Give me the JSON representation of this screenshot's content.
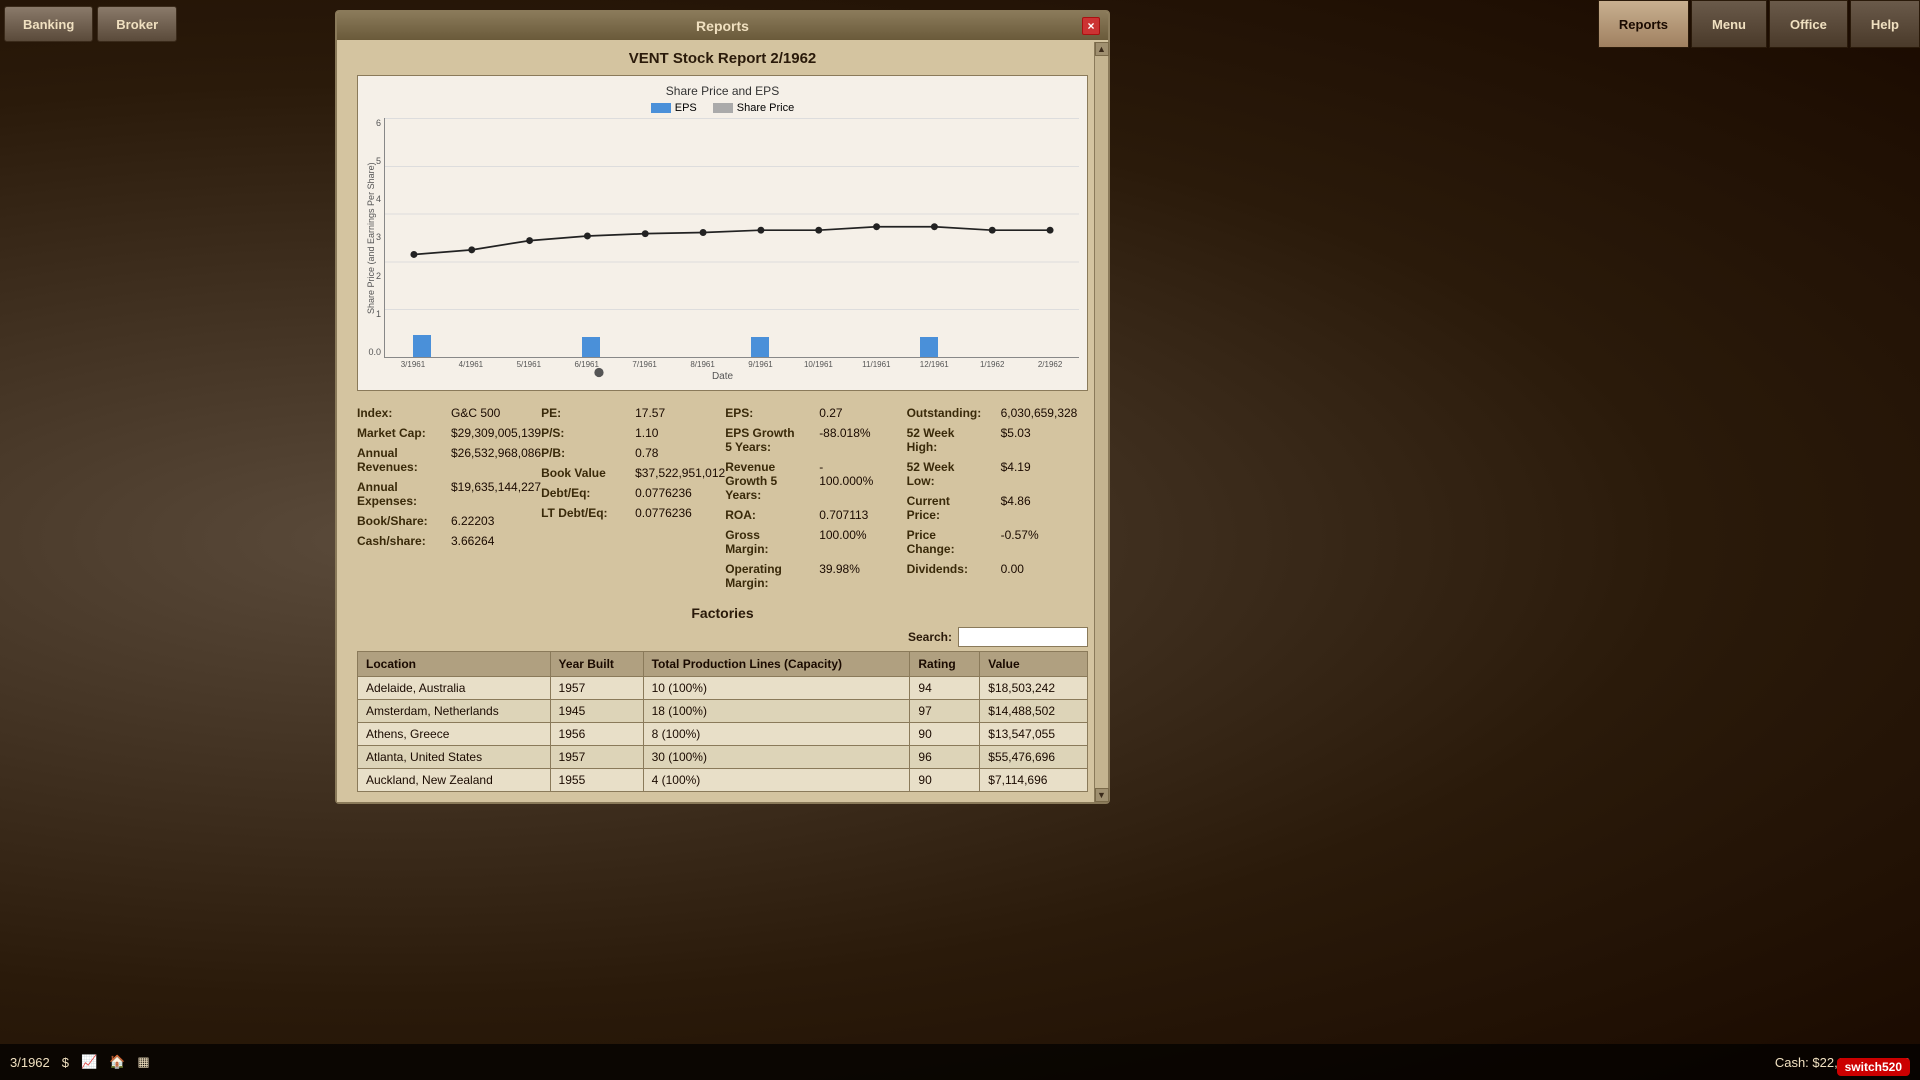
{
  "topbar": {
    "left_buttons": [
      {
        "label": "Banking",
        "id": "banking"
      },
      {
        "label": "Broker",
        "id": "broker"
      }
    ],
    "right_buttons": [
      {
        "label": "Reports",
        "id": "reports",
        "active": true
      },
      {
        "label": "Menu",
        "id": "menu"
      },
      {
        "label": "Office",
        "id": "office"
      },
      {
        "label": "Help",
        "id": "help"
      }
    ]
  },
  "window": {
    "title": "Reports",
    "close_label": "×"
  },
  "report": {
    "title": "VENT Stock Report 2/1962",
    "chart": {
      "title": "Share Price and EPS",
      "legend_eps": "EPS",
      "legend_price": "Share Price",
      "y_label": "Share Price (and Earnings Per Share)",
      "x_label": "Date",
      "x_labels": [
        "3/1961",
        "4/1961",
        "5/1961",
        "6/1961",
        "7/1961",
        "8/1961",
        "9/1961",
        "10/1961",
        "11/1961",
        "12/1961",
        "1/1962",
        "2/1962"
      ],
      "y_values": [
        "0.0",
        "1",
        "2",
        "3",
        "4",
        "5",
        "6"
      ],
      "bar_heights_pct": [
        20,
        2,
        2,
        18,
        2,
        2,
        17,
        2,
        2,
        16,
        2,
        2
      ],
      "line_points": "45,108 90,105 135,98 175,95 220,93 265,92 310,90 355,90 400,88 445,88 490,90 535,90"
    },
    "stats": {
      "col1": [
        {
          "label": "Index:",
          "value": "G&C 500"
        },
        {
          "label": "Market Cap:",
          "value": "$29,309,005,139"
        },
        {
          "label": "Annual Revenues:",
          "value": "$26,532,968,086"
        },
        {
          "label": "Annual Expenses:",
          "value": "$19,635,144,227"
        },
        {
          "label": "Book/Share:",
          "value": "6.22203"
        },
        {
          "label": "Cash/share:",
          "value": "3.66264"
        }
      ],
      "col2": [
        {
          "label": "PE:",
          "value": "17.57"
        },
        {
          "label": "P/S:",
          "value": "1.10"
        },
        {
          "label": "P/B:",
          "value": "0.78"
        },
        {
          "label": "Book Value",
          "value": "$37,522,951,012"
        },
        {
          "label": "Debt/Eq:",
          "value": "0.0776236"
        },
        {
          "label": "LT Debt/Eq:",
          "value": "0.0776236"
        }
      ],
      "col3": [
        {
          "label": "EPS:",
          "value": "0.27"
        },
        {
          "label": "EPS Growth 5 Years:",
          "value": "-88.018%"
        },
        {
          "label": "Revenue Growth 5 Years:",
          "value": "-\n100.000%"
        },
        {
          "label": "ROA:",
          "value": "0.707113"
        },
        {
          "label": "Gross Margin:",
          "value": "100.00%"
        },
        {
          "label": "Operating Margin:",
          "value": "39.98%"
        }
      ],
      "col4": [
        {
          "label": "Outstanding:",
          "value": "6,030,659,328"
        },
        {
          "label": "52 Week High:",
          "value": "$5.03"
        },
        {
          "label": "52 Week Low:",
          "value": "$4.19"
        },
        {
          "label": "Current Price:",
          "value": "$4.86"
        },
        {
          "label": "Price Change:",
          "value": "-0.57%"
        },
        {
          "label": "Dividends:",
          "value": "0.00"
        }
      ]
    },
    "factories": {
      "title": "Factories",
      "search_label": "Search:",
      "search_placeholder": "",
      "columns": [
        "Location",
        "Year Built",
        "Total Production Lines (Capacity)",
        "Rating",
        "Value"
      ],
      "rows": [
        {
          "location": "Adelaide, Australia",
          "year": "1957",
          "lines": "10  (100%)",
          "rating": "94",
          "value": "$18,503,242"
        },
        {
          "location": "Amsterdam, Netherlands",
          "year": "1945",
          "lines": "18  (100%)",
          "rating": "97",
          "value": "$14,488,502"
        },
        {
          "location": "Athens, Greece",
          "year": "1956",
          "lines": "8   (100%)",
          "rating": "90",
          "value": "$13,547,055"
        },
        {
          "location": "Atlanta, United States",
          "year": "1957",
          "lines": "30  (100%)",
          "rating": "96",
          "value": "$55,476,696"
        },
        {
          "location": "Auckland, New Zealand",
          "year": "1955",
          "lines": "4   (100%)",
          "rating": "90",
          "value": "$7,114,696"
        }
      ]
    }
  },
  "bottom_bar": {
    "date": "3/1962",
    "cash": "Cash: $22,088,144,753",
    "switch_label": "switch520"
  }
}
